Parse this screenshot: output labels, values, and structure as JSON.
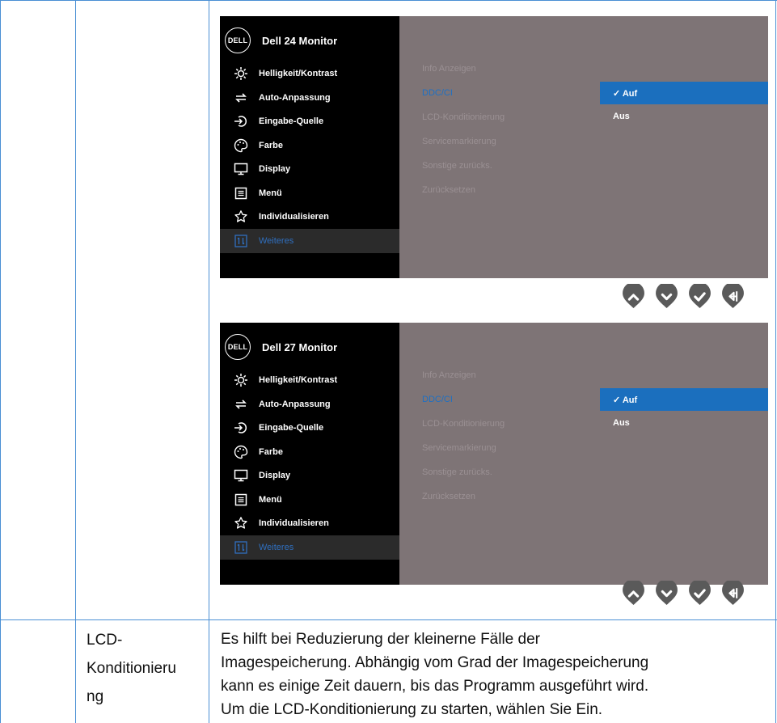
{
  "osd_panels": [
    {
      "logo": "DELL",
      "title": "Dell 24 Monitor",
      "menu": [
        {
          "icon": "brightness-icon",
          "label": "Helligkeit/Kontrast"
        },
        {
          "icon": "auto-adjust-icon",
          "label": "Auto-Anpassung"
        },
        {
          "icon": "input-source-icon",
          "label": "Eingabe-Quelle"
        },
        {
          "icon": "color-palette-icon",
          "label": "Farbe"
        },
        {
          "icon": "display-icon",
          "label": "Display"
        },
        {
          "icon": "menu-icon",
          "label": "Menü"
        },
        {
          "icon": "star-icon",
          "label": "Individualisieren"
        },
        {
          "icon": "others-icon",
          "label": "Weiteres",
          "active": true
        }
      ],
      "submenu": [
        {
          "label": "Info Anzeigen"
        },
        {
          "label": "DDC/CI",
          "active": true
        },
        {
          "label": "LCD-Konditionierung"
        },
        {
          "label": "Servicemarkierung"
        },
        {
          "label": "Sonstige zurücks."
        },
        {
          "label": "Zurücksetzen"
        }
      ],
      "options": [
        {
          "label": "✓ Auf",
          "selected": true
        },
        {
          "label": "Aus",
          "selected": false
        }
      ]
    },
    {
      "logo": "DELL",
      "title": "Dell 27 Monitor",
      "menu": [
        {
          "icon": "brightness-icon",
          "label": "Helligkeit/Kontrast"
        },
        {
          "icon": "auto-adjust-icon",
          "label": "Auto-Anpassung"
        },
        {
          "icon": "input-source-icon",
          "label": "Eingabe-Quelle"
        },
        {
          "icon": "color-palette-icon",
          "label": "Farbe"
        },
        {
          "icon": "display-icon",
          "label": "Display"
        },
        {
          "icon": "menu-icon",
          "label": "Menü"
        },
        {
          "icon": "star-icon",
          "label": "Individualisieren"
        },
        {
          "icon": "others-icon",
          "label": "Weiteres",
          "active": true
        }
      ],
      "submenu": [
        {
          "label": "Info Anzeigen"
        },
        {
          "label": "DDC/CI",
          "active": true
        },
        {
          "label": "LCD-Konditionierung"
        },
        {
          "label": "Servicemarkierung"
        },
        {
          "label": "Sonstige zurücks."
        },
        {
          "label": "Zurücksetzen"
        }
      ],
      "options": [
        {
          "label": "✓ Auf",
          "selected": true
        },
        {
          "label": "Aus",
          "selected": false
        }
      ]
    }
  ],
  "nav_buttons": [
    "up-icon",
    "down-icon",
    "check-icon",
    "back-icon"
  ],
  "colors": {
    "menu_bg": "#000000",
    "panel_bg": "#7e7476",
    "highlight": "#1b6fbe",
    "nav_button": "#5a5a5a",
    "grid_line": "#4a8fd4"
  },
  "row": {
    "feature_lines": [
      "LCD-",
      "Konditionieru",
      "ng"
    ],
    "description_lines": [
      "Es  hilft bei Reduzierung der kleinerne Fälle der",
      "Imagespeicherung. Abhängig vom Grad der Imagespeicherung",
      "kann es einige Zeit dauern, bis das Programm ausgeführt wird.",
      "Um die LCD-Konditionierung zu starten, wählen Sie Ein."
    ]
  }
}
